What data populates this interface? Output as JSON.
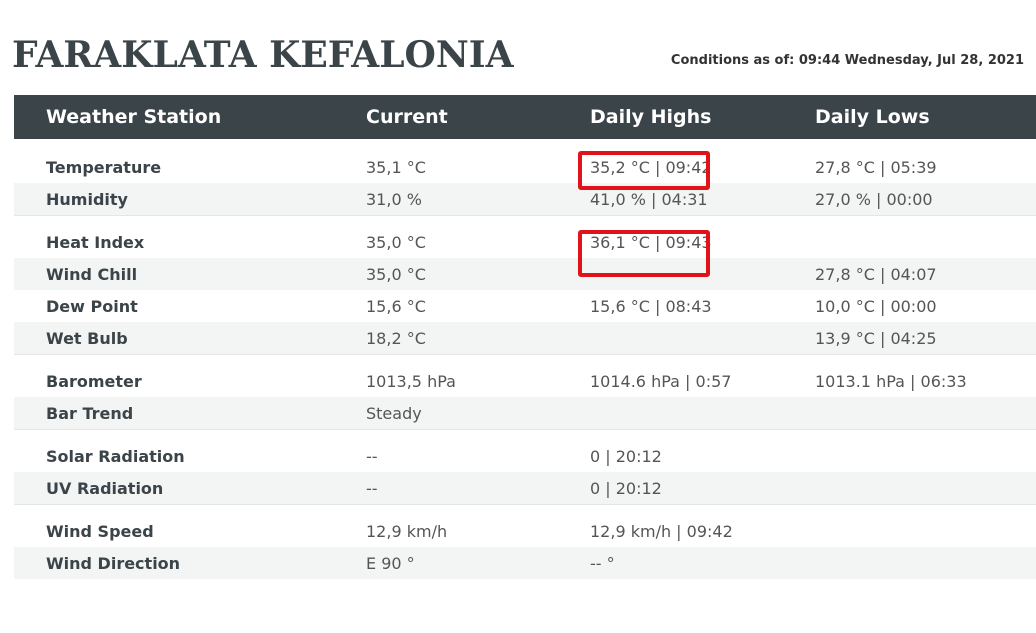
{
  "page": {
    "title": "FARAKLATA KEFALONIA",
    "conditions": "Conditions as of: 09:44 Wednesday, Jul 28, 2021"
  },
  "table": {
    "headers": [
      "Weather Station",
      "Current",
      "Daily Highs",
      "Daily Lows"
    ],
    "groups": [
      [
        {
          "label": "Temperature",
          "current": "35,1 °C",
          "high": "35,2 °C | 09:42",
          "low": "27,8 °C | 05:39"
        },
        {
          "label": "Humidity",
          "current": "31,0 %",
          "high": "41,0 % | 04:31",
          "low": "27,0 % | 00:00"
        }
      ],
      [
        {
          "label": "Heat Index",
          "current": "35,0 °C",
          "high": "36,1 °C | 09:43",
          "low": ""
        },
        {
          "label": "Wind Chill",
          "current": "35,0 °C",
          "high": "",
          "low": "27,8 °C | 04:07"
        },
        {
          "label": "Dew Point",
          "current": "15,6 °C",
          "high": "15,6 °C | 08:43",
          "low": "10,0 °C | 00:00"
        },
        {
          "label": "Wet Bulb",
          "current": "18,2 °C",
          "high": "",
          "low": "13,9 °C | 04:25"
        }
      ],
      [
        {
          "label": "Barometer",
          "current": "1013,5 hPa",
          "high": "1014.6 hPa | 0:57",
          "low": "1013.1 hPa | 06:33"
        },
        {
          "label": "Bar Trend",
          "current": "Steady",
          "high": "",
          "low": ""
        }
      ],
      [
        {
          "label": "Solar Radiation",
          "current": "--",
          "high": "0 | 20:12",
          "low": ""
        },
        {
          "label": "UV Radiation",
          "current": "--",
          "high": "0 | 20:12",
          "low": ""
        }
      ],
      [
        {
          "label": "Wind Speed",
          "current": "12,9 km/h",
          "high": "12,9 km/h | 09:42",
          "low": ""
        },
        {
          "label": "Wind Direction",
          "current": "E 90 °",
          "high": "-- °",
          "low": ""
        }
      ]
    ]
  },
  "highlight_color": "#e1131a"
}
